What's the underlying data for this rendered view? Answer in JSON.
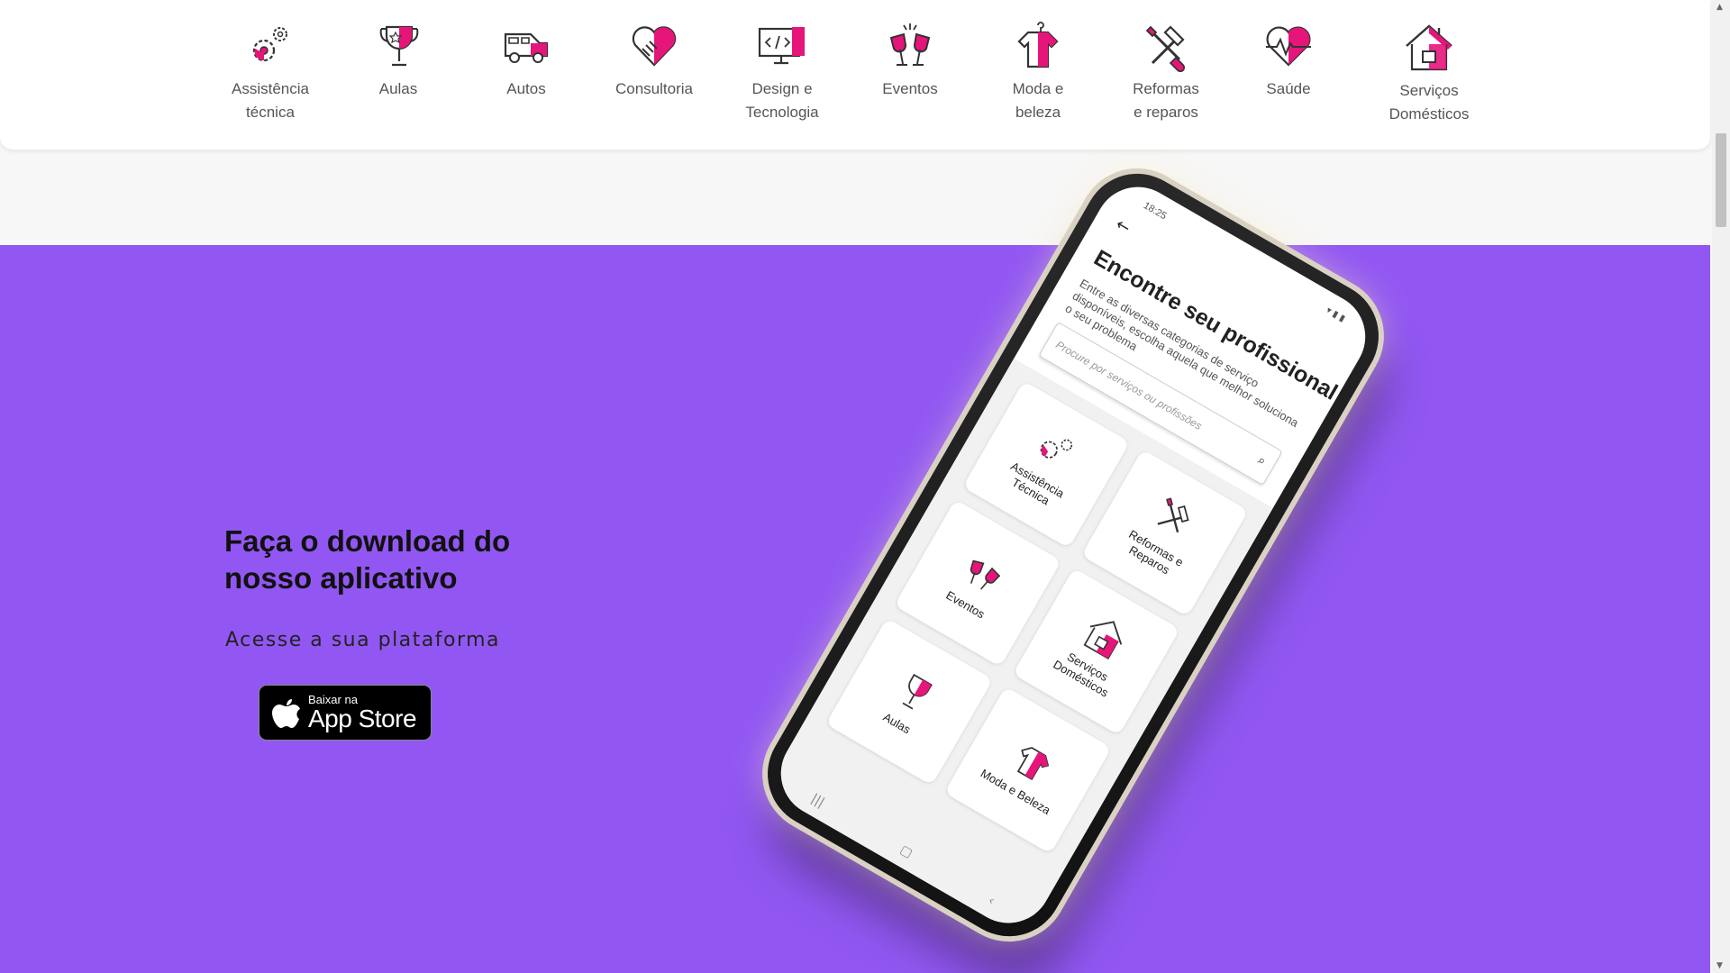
{
  "categories": [
    {
      "label": "Assistência\ntécnica",
      "icon": "gears-icon"
    },
    {
      "label": "Aulas",
      "icon": "trophy-icon"
    },
    {
      "label": "Autos",
      "icon": "car-icon"
    },
    {
      "label": "Consultoria",
      "icon": "handshake-icon"
    },
    {
      "label": "Design e\nTecnologia",
      "icon": "monitor-code-icon"
    },
    {
      "label": "Eventos",
      "icon": "toast-glasses-icon"
    },
    {
      "label": "Moda e\nbeleza",
      "icon": "shirt-icon"
    },
    {
      "label": "Reformas\ne reparos",
      "icon": "hammer-wrench-icon"
    },
    {
      "label": "Saúde",
      "icon": "heart-pulse-icon"
    },
    {
      "label": "Serviços\nDomésticos",
      "icon": "house-icon"
    }
  ],
  "promo": {
    "title": "Faça o download do nosso aplicativo",
    "subtitle": "Acesse a sua plataforma",
    "appstore_small": "Baixar na",
    "appstore_big": "App Store"
  },
  "phone": {
    "time": "18:25",
    "title": "Encontre seu profissional",
    "description": "Entre as diversas categorias de serviço disponíveis, escolha aquela que melhor soluciona o seu problema",
    "search_placeholder": "Procure por serviços ou profissões",
    "tiles": [
      {
        "label": "Assistência\nTécnica",
        "icon": "gears-icon"
      },
      {
        "label": "Reformas e\nReparos",
        "icon": "hammer-wrench-icon"
      },
      {
        "label": "Eventos",
        "icon": "toast-glasses-icon"
      },
      {
        "label": "Serviços\nDomésticos",
        "icon": "house-icon"
      },
      {
        "label": "Aulas",
        "icon": "trophy-icon"
      },
      {
        "label": "Moda e Beleza",
        "icon": "shirt-icon"
      }
    ]
  },
  "colors": {
    "accent_pink": "#e6157a",
    "purple_bg": "#9257f2",
    "icon_stroke": "#333333"
  }
}
